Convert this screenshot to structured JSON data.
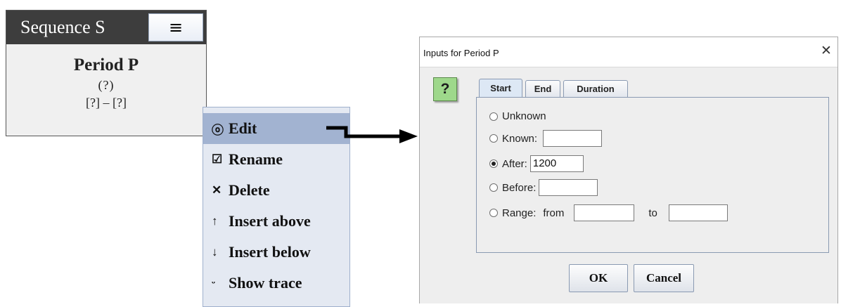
{
  "sequence_panel": {
    "title": "Sequence S",
    "menu_icon": "hamburger-menu-icon",
    "menu_glyph": "≡",
    "period_title": "Period P",
    "period_subtitle": "(?)",
    "period_range": "[?] – [?]"
  },
  "context_menu": {
    "items": [
      {
        "label": "Edit",
        "icon": "timer-icon",
        "glyph": "ⓞ",
        "selected": true
      },
      {
        "label": "Rename",
        "icon": "rename-edit-icon",
        "glyph": "☑",
        "selected": false
      },
      {
        "label": "Delete",
        "icon": "delete-x-icon",
        "glyph": "✕",
        "selected": false
      },
      {
        "label": "Insert above",
        "icon": "arrow-up-icon",
        "glyph": "↑",
        "selected": false
      },
      {
        "label": "Insert below",
        "icon": "arrow-down-icon",
        "glyph": "↓",
        "selected": false
      },
      {
        "label": "Show trace",
        "icon": "trace-icon",
        "glyph": "ᵕ",
        "selected": false
      }
    ]
  },
  "dialog": {
    "title": "Inputs for Period P",
    "close_glyph": "✕",
    "help_glyph": "?",
    "tabs": [
      {
        "label": "Start",
        "active": true
      },
      {
        "label": "End",
        "active": false
      },
      {
        "label": "Duration",
        "active": false
      }
    ],
    "options": {
      "unknown_label": "Unknown",
      "known_label": "Known:",
      "known_value": "",
      "after_label": "After:",
      "after_value": "1200",
      "before_label": "Before:",
      "before_value": "",
      "range_label": "Range:",
      "range_from_label": "from",
      "range_from_value": "",
      "range_to_label": "to",
      "range_to_value": "",
      "selected": "After"
    },
    "ok_label": "OK",
    "cancel_label": "Cancel"
  },
  "colors": {
    "header_bg": "#3d3d3d",
    "menu_bg": "#e4e9f2",
    "menu_selected": "#a2b3d1",
    "help_green": "#9ed88b"
  }
}
